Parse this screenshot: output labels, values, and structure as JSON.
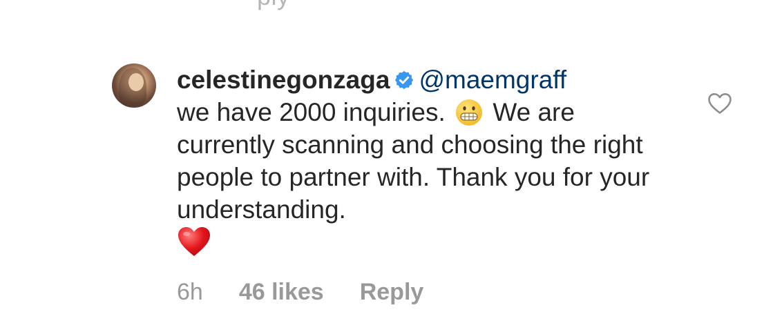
{
  "top_cut_text": "ply",
  "comment": {
    "username": "celestinegonzaga",
    "verified": true,
    "mention": "@maemgraff",
    "text_line1": "we have 2000 inquiries.",
    "text_after_emoji": "We are currently scanning and choosing the right people to partner with. Thank you for your understanding.",
    "emoji_1": "grimacing-face",
    "emoji_2": "red-heart"
  },
  "meta": {
    "time": "6h",
    "likes": "46 likes",
    "reply_label": "Reply"
  },
  "colors": {
    "text": "#262626",
    "mention": "#003569",
    "meta": "#999999",
    "verified": "#3897f0"
  },
  "icons": {
    "like": "heart-outline-icon",
    "verified": "verified-badge-icon"
  }
}
